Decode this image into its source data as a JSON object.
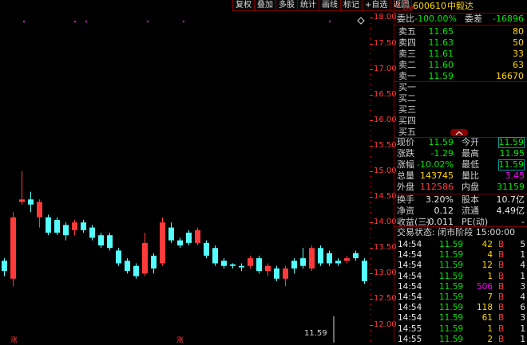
{
  "toolbar": [
    "复权",
    "叠加",
    "多股",
    "统计",
    "画线",
    "标记",
    "+自选",
    "返回"
  ],
  "chart": {
    "ymin": 11.65,
    "ymax": 18.35,
    "ticks": [
      "18.00",
      "17.50",
      "17.00",
      "16.50",
      "16.00",
      "15.50",
      "15.00",
      "14.50",
      "14.00",
      "13.50",
      "13.00",
      "12.50",
      "12.00"
    ],
    "last_price_label": "11.59",
    "bottom_markers": [
      "涨",
      "涨"
    ],
    "candles": [
      {
        "o": 13.25,
        "c": 13.05,
        "h": 13.3,
        "l": 12.95,
        "up": false
      },
      {
        "o": 12.9,
        "c": 14.1,
        "h": 14.2,
        "l": 12.75,
        "up": true
      },
      {
        "o": 14.4,
        "c": 14.45,
        "h": 15.0,
        "l": 14.35,
        "up": true
      },
      {
        "o": 14.45,
        "c": 14.35,
        "h": 14.6,
        "l": 14.2,
        "up": false
      },
      {
        "o": 14.1,
        "c": 14.4,
        "h": 14.45,
        "l": 13.9,
        "up": true
      },
      {
        "o": 14.1,
        "c": 13.8,
        "h": 14.15,
        "l": 13.75,
        "up": false
      },
      {
        "o": 14.05,
        "c": 13.8,
        "h": 14.1,
        "l": 13.75,
        "up": false
      },
      {
        "o": 13.95,
        "c": 13.75,
        "h": 14.0,
        "l": 13.65,
        "up": false
      },
      {
        "o": 13.85,
        "c": 14.0,
        "h": 14.05,
        "l": 13.75,
        "up": true
      },
      {
        "o": 14.0,
        "c": 13.85,
        "h": 14.05,
        "l": 13.8,
        "up": false
      },
      {
        "o": 13.9,
        "c": 13.7,
        "h": 13.95,
        "l": 13.65,
        "up": false
      },
      {
        "o": 13.75,
        "c": 13.55,
        "h": 13.8,
        "l": 13.5,
        "up": false
      },
      {
        "o": 13.75,
        "c": 13.5,
        "h": 13.8,
        "l": 13.45,
        "up": false
      },
      {
        "o": 13.45,
        "c": 13.2,
        "h": 13.5,
        "l": 13.15,
        "up": false
      },
      {
        "o": 13.25,
        "c": 13.05,
        "h": 13.3,
        "l": 13.0,
        "up": false
      },
      {
        "o": 13.15,
        "c": 12.95,
        "h": 13.2,
        "l": 12.9,
        "up": false
      },
      {
        "o": 13.0,
        "c": 13.6,
        "h": 13.8,
        "l": 12.95,
        "up": true
      },
      {
        "o": 13.35,
        "c": 13.1,
        "h": 13.4,
        "l": 13.0,
        "up": false
      },
      {
        "o": 13.2,
        "c": 14.0,
        "h": 14.1,
        "l": 13.15,
        "up": true
      },
      {
        "o": 13.9,
        "c": 13.65,
        "h": 14.0,
        "l": 13.6,
        "up": false
      },
      {
        "o": 13.65,
        "c": 13.55,
        "h": 13.7,
        "l": 13.5,
        "up": false
      },
      {
        "o": 13.8,
        "c": 13.6,
        "h": 13.85,
        "l": 13.55,
        "up": false
      },
      {
        "o": 13.6,
        "c": 13.85,
        "h": 13.9,
        "l": 13.55,
        "up": true
      },
      {
        "o": 13.6,
        "c": 13.35,
        "h": 13.65,
        "l": 13.3,
        "up": false
      },
      {
        "o": 13.5,
        "c": 13.2,
        "h": 13.55,
        "l": 13.15,
        "up": false
      },
      {
        "o": 13.25,
        "c": 13.15,
        "h": 13.3,
        "l": 13.1,
        "up": false
      },
      {
        "o": 13.18,
        "c": 13.15,
        "h": 13.2,
        "l": 13.1,
        "up": false
      },
      {
        "o": 13.15,
        "c": 13.12,
        "h": 13.2,
        "l": 13.05,
        "up": false
      },
      {
        "o": 13.15,
        "c": 13.3,
        "h": 13.35,
        "l": 13.1,
        "up": true
      },
      {
        "o": 13.3,
        "c": 13.05,
        "h": 13.35,
        "l": 13.0,
        "up": false
      },
      {
        "o": 13.05,
        "c": 13.15,
        "h": 13.2,
        "l": 12.95,
        "up": true
      },
      {
        "o": 13.1,
        "c": 12.9,
        "h": 13.15,
        "l": 12.85,
        "up": false
      },
      {
        "o": 12.9,
        "c": 13.1,
        "h": 13.15,
        "l": 12.75,
        "up": true
      },
      {
        "o": 13.25,
        "c": 13.1,
        "h": 13.3,
        "l": 13.0,
        "up": false
      },
      {
        "o": 13.3,
        "c": 13.15,
        "h": 13.5,
        "l": 13.1,
        "up": false
      },
      {
        "o": 13.1,
        "c": 13.5,
        "h": 13.55,
        "l": 13.05,
        "up": true
      },
      {
        "o": 13.5,
        "c": 13.2,
        "h": 13.55,
        "l": 13.15,
        "up": false
      },
      {
        "o": 13.4,
        "c": 13.2,
        "h": 13.45,
        "l": 13.15,
        "up": false
      },
      {
        "o": 13.25,
        "c": 13.2,
        "h": 13.3,
        "l": 13.15,
        "up": false
      },
      {
        "o": 13.25,
        "c": 13.3,
        "h": 13.35,
        "l": 13.2,
        "up": true
      },
      {
        "o": 13.4,
        "c": 13.3,
        "h": 13.45,
        "l": 13.25,
        "up": false
      },
      {
        "o": 13.25,
        "c": 12.85,
        "h": 13.3,
        "l": 12.8,
        "up": false
      }
    ]
  },
  "quote": {
    "title_prefix": "L",
    "title_badge": "R",
    "title_badge_sub": "1000",
    "code": "600610",
    "name": "中毅达",
    "weibi_label": "委比",
    "weibi": "-100.00%",
    "weicha_label": "委差",
    "weicha": "-16896",
    "asks": [
      {
        "label": "卖五",
        "price": "11.65",
        "vol": "80"
      },
      {
        "label": "卖四",
        "price": "11.63",
        "vol": "50"
      },
      {
        "label": "卖三",
        "price": "11.61",
        "vol": "33"
      },
      {
        "label": "卖二",
        "price": "11.60",
        "vol": "63"
      },
      {
        "label": "卖一",
        "price": "11.59",
        "vol": "16670"
      }
    ],
    "bids": [
      "买一",
      "买二",
      "买三",
      "买四",
      "买五"
    ],
    "stats": [
      {
        "l1": "现价",
        "v1": "11.59",
        "c1": "green",
        "l2": "今开",
        "v2": "11.59",
        "c2": "green",
        "box2": true
      },
      {
        "l1": "涨跌",
        "v1": "-1.29",
        "c1": "green",
        "l2": "最高",
        "v2": "11.95",
        "c2": "green",
        "box2": false
      },
      {
        "l1": "涨幅",
        "v1": "-10.02%",
        "c1": "green",
        "l2": "最低",
        "v2": "11.59",
        "c2": "green",
        "box2": true
      },
      {
        "l1": "总量",
        "v1": "143745",
        "c1": "yellow",
        "l2": "量比",
        "v2": "3.45",
        "c2": "magenta",
        "box2": false
      },
      {
        "l1": "外盘",
        "v1": "112586",
        "c1": "red",
        "l2": "内盘",
        "v2": "31159",
        "c2": "green",
        "box2": false
      },
      {
        "l1": "换手",
        "v1": "3.20%",
        "c1": "white",
        "l2": "股本",
        "v2": "10.7亿",
        "c2": "white",
        "box2": false
      },
      {
        "l1": "净资",
        "v1": "0.12",
        "c1": "white",
        "l2": "流通",
        "v2": "4.49亿",
        "c2": "white",
        "box2": false
      },
      {
        "l1": "收益(三)",
        "v1": "-0.011",
        "c1": "white",
        "l2": "PE(动)",
        "v2": "-",
        "c2": "white",
        "box2": false
      }
    ],
    "trade_status": "交易状态: 闭市阶段 15:00:00",
    "trades": [
      {
        "t": "14:54",
        "p": "11.59",
        "v": "42",
        "vc": "yellow",
        "bs": "B",
        "n": "5"
      },
      {
        "t": "14:54",
        "p": "11.59",
        "v": "4",
        "vc": "yellow",
        "bs": "B",
        "n": "1"
      },
      {
        "t": "14:54",
        "p": "11.59",
        "v": "12",
        "vc": "yellow",
        "bs": "B",
        "n": "4"
      },
      {
        "t": "14:54",
        "p": "11.59",
        "v": "1",
        "vc": "yellow",
        "bs": "B",
        "n": "1"
      },
      {
        "t": "14:54",
        "p": "11.59",
        "v": "506",
        "vc": "magenta",
        "bs": "B",
        "n": "3"
      },
      {
        "t": "14:54",
        "p": "11.59",
        "v": "7",
        "vc": "yellow",
        "bs": "B",
        "n": "4"
      },
      {
        "t": "14:54",
        "p": "11.59",
        "v": "118",
        "vc": "yellow",
        "bs": "B",
        "n": "6"
      },
      {
        "t": "14:54",
        "p": "11.59",
        "v": "61",
        "vc": "yellow",
        "bs": "B",
        "n": "3"
      },
      {
        "t": "14:55",
        "p": "11.59",
        "v": "1",
        "vc": "yellow",
        "bs": "B",
        "n": "1"
      },
      {
        "t": "14:55",
        "p": "11.59",
        "v": "2",
        "vc": "yellow",
        "bs": "B",
        "n": "1"
      }
    ]
  }
}
